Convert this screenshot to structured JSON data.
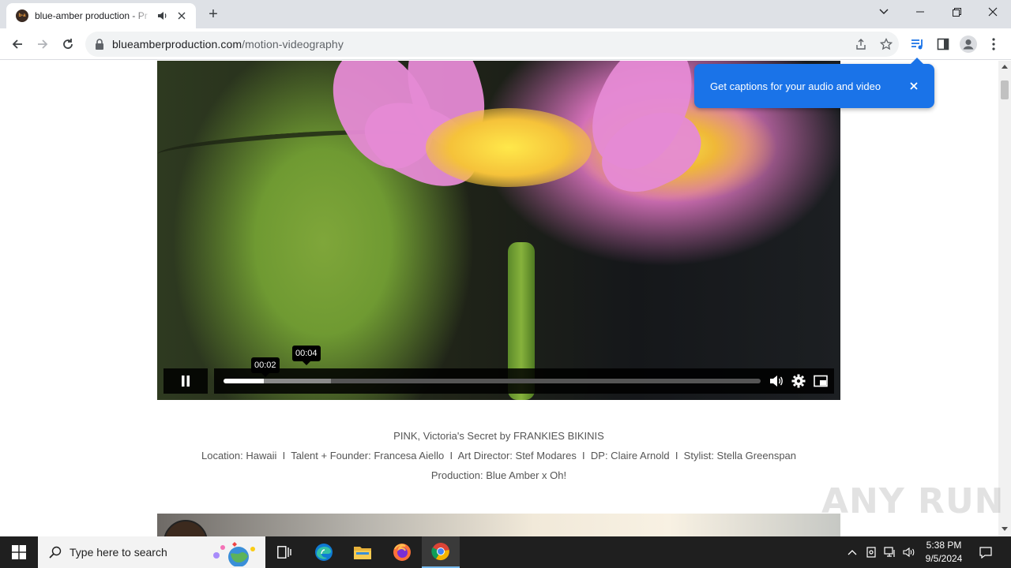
{
  "browser": {
    "tab": {
      "title": "blue-amber production - Pr",
      "favicon_text": "b-a"
    },
    "new_tab_label": "+",
    "address": {
      "domain": "blueamberproduction.com",
      "path": "/motion-videography"
    }
  },
  "video": {
    "tooltip_hover": "00:02",
    "tooltip_current": "00:04",
    "progress": {
      "played_fraction": 0.075,
      "buffered_fraction": 0.2
    }
  },
  "captions": {
    "line1": "PINK, Victoria's Secret by FRANKIES BIKINIS",
    "line2": "Location: Hawaii  I  Talent + Founder: Francesa Aiello  I  Art Director: Stef Modares  I  DP: Claire Arnold  I  Stylist: Stella Greenspan",
    "line3": "Production: Blue Amber x Oh!"
  },
  "bubble": {
    "text": "Get captions for your audio and video"
  },
  "watermark": "ANY RUN",
  "taskbar": {
    "search_placeholder": "Type here to search",
    "time": "5:38 PM",
    "date": "9/5/2024"
  },
  "colors": {
    "accent": "#1a73e8",
    "taskbar": "#1f1f1f",
    "tabstrip": "#dee1e6"
  }
}
